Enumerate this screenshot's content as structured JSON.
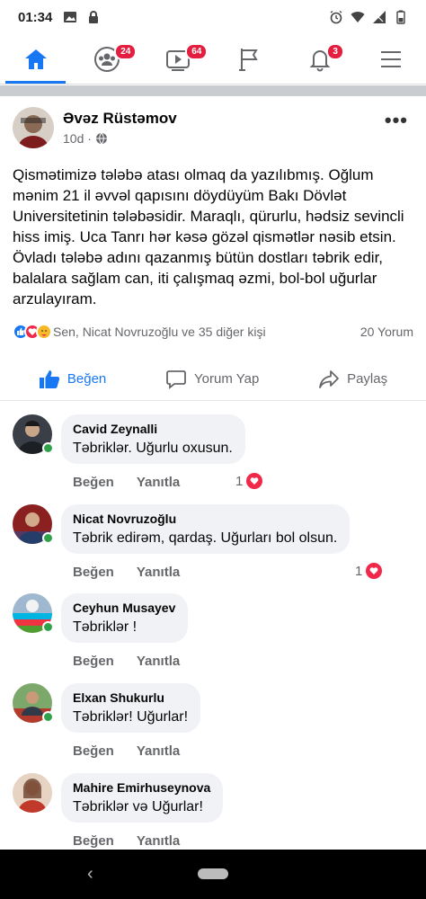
{
  "status_bar": {
    "time": "01:34"
  },
  "nav": {
    "tabs": [
      {
        "name": "home",
        "badge": ""
      },
      {
        "name": "groups",
        "badge": "24"
      },
      {
        "name": "watch",
        "badge": "64"
      },
      {
        "name": "pages",
        "badge": ""
      },
      {
        "name": "notifications",
        "badge": "3"
      },
      {
        "name": "menu",
        "badge": ""
      }
    ],
    "accent_color": "#1877f2"
  },
  "post": {
    "author": "Əvəz Rüstəmov",
    "time": "10d ·",
    "text": "Qismətimizə tələbə atası olmaq da yazılıbmış. Oğlum mənim 21 il əvvəl qapısını döydüyüm Bakı Dövlət Universitetinin tələbəsidir. Maraqlı, qürurlu, hədsiz sevincli hiss imiş. Uca Tanrı hər kəsə gözəl qismətlər nəsib etsin. Övladı tələbə adını qazanmış bütün dostları təbrik edir, balalara sağlam can, iti çalışmaq əzmi, bol-bol uğurlar arzulayıram.",
    "reactions_text": "Sen, Nicat Novruzoğlu ve 35 diğer kişi",
    "comments_count": "20 Yorum",
    "actions": {
      "like": "Beğen",
      "comment": "Yorum Yap",
      "share": "Paylaş"
    }
  },
  "comments": [
    {
      "name": "Cavid Zeynalli",
      "text": "Təbriklər. Uğurlu oxusun.",
      "like": "Beğen",
      "reply": "Yanıtla",
      "reactions": "1"
    },
    {
      "name": "Nicat Novruzoğlu",
      "text": "Təbrik edirəm, qardaş. Uğurları bol olsun.",
      "like": "Beğen",
      "reply": "Yanıtla",
      "reactions": "1"
    },
    {
      "name": "Ceyhun Musayev",
      "text": "Təbriklər !",
      "like": "Beğen",
      "reply": "Yanıtla",
      "reactions": ""
    },
    {
      "name": "Elxan Shukurlu",
      "text": "Təbriklər! Uğurlar!",
      "like": "Beğen",
      "reply": "Yanıtla",
      "reactions": ""
    },
    {
      "name": "Mahire Emirhuseynova",
      "text": "Təbriklər və Uğurlar!",
      "like": "Beğen",
      "reply": "Yanıtla",
      "reactions": ""
    }
  ]
}
